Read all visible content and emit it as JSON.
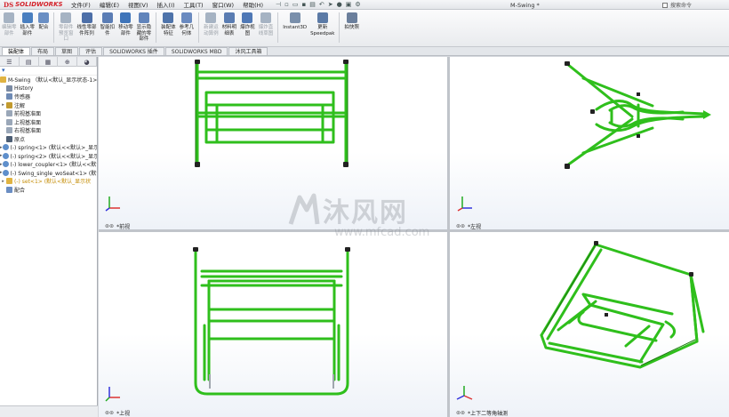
{
  "app": {
    "brand_ds": "DS",
    "brand_name": "SOLIDWORKS",
    "document_title": "M-Swing *",
    "search_label": "搜索命令"
  },
  "menus": [
    "文件(F)",
    "编辑(E)",
    "视图(V)",
    "插入(I)",
    "工具(T)",
    "窗口(W)",
    "帮助(H)"
  ],
  "toolbar": {
    "buttons": [
      {
        "label": "编辑零\n部件",
        "icon": "edit-component-icon",
        "enabled": false
      },
      {
        "label": "插入零\n部件",
        "icon": "insert-components-icon",
        "enabled": true
      },
      {
        "label": "配合",
        "icon": "mate-icon",
        "enabled": true
      },
      {
        "label": "零部件\n预览窗\n口",
        "icon": "component-preview-icon",
        "enabled": false
      },
      {
        "label": "线性零部\n件阵列",
        "icon": "linear-pattern-icon",
        "enabled": true
      },
      {
        "label": "智能扣\n件",
        "icon": "smart-fasteners-icon",
        "enabled": true
      },
      {
        "label": "移动零\n部件",
        "icon": "move-component-icon",
        "enabled": true
      },
      {
        "label": "显示隐\n藏的零\n部件",
        "icon": "show-hidden-icon",
        "enabled": true
      },
      {
        "label": "装配体\n特征",
        "icon": "assembly-features-icon",
        "enabled": true
      },
      {
        "label": "参考几\n何体",
        "icon": "reference-geometry-icon",
        "enabled": true
      },
      {
        "label": "新建运\n动算例",
        "icon": "new-motion-study-icon",
        "enabled": false
      },
      {
        "label": "材料明\n细表",
        "icon": "bom-icon",
        "enabled": true
      },
      {
        "label": "爆炸视\n图",
        "icon": "exploded-view-icon",
        "enabled": true
      },
      {
        "label": "爆炸直\n线草图",
        "icon": "explode-line-sketch-icon",
        "enabled": false
      },
      {
        "label": "Instant3D",
        "icon": "instant3d-icon",
        "enabled": true
      },
      {
        "label": "更新\nSpeedpak",
        "icon": "speedpak-icon",
        "enabled": true
      },
      {
        "label": "拍快照",
        "icon": "snapshot-icon",
        "enabled": true
      }
    ]
  },
  "tabs": [
    {
      "label": "装配体",
      "active": true
    },
    {
      "label": "布局",
      "active": false
    },
    {
      "label": "草图",
      "active": false
    },
    {
      "label": "评估",
      "active": false
    },
    {
      "label": "SOLIDWORKS 插件",
      "active": false
    },
    {
      "label": "SOLIDWORKS MBD",
      "active": false
    },
    {
      "label": "沐风工具箱",
      "active": false
    }
  ],
  "feature_tree": {
    "root": "M-Swing （默认<默认_显示状态-1>）",
    "items": [
      {
        "label": "History",
        "icon": "history-icon",
        "exp": ""
      },
      {
        "label": "传感器",
        "icon": "sensor-icon",
        "exp": ""
      },
      {
        "label": "注解",
        "icon": "annotation-icon",
        "exp": "▸"
      },
      {
        "label": "前视基准面",
        "icon": "plane-icon",
        "exp": ""
      },
      {
        "label": "上视基准面",
        "icon": "plane-icon",
        "exp": ""
      },
      {
        "label": "右视基准面",
        "icon": "plane-icon",
        "exp": ""
      },
      {
        "label": "原点",
        "icon": "origin-icon",
        "exp": ""
      },
      {
        "label": "(-) spring<1> (默认<<默认>_显示",
        "icon": "part-icon",
        "exp": "▸"
      },
      {
        "label": "(-) spring<2> (默认<<默认>_显示",
        "icon": "part-icon",
        "exp": "▸"
      },
      {
        "label": "(-) lower_coupler<1> (默认<<默认",
        "icon": "part-icon",
        "exp": "▸"
      },
      {
        "label": "(-) Swing_single_woSeat<1> (默认",
        "icon": "part-icon",
        "exp": "▸"
      },
      {
        "label": "(-) set<1> (默认<默认_显示状",
        "icon": "warning-icon",
        "exp": "▸",
        "warn": true
      },
      {
        "label": "配合",
        "icon": "mates-folder-icon",
        "exp": ""
      }
    ]
  },
  "viewports": [
    {
      "label": "*前视"
    },
    {
      "label": "*左视"
    },
    {
      "label": "*上视"
    },
    {
      "label": "*上下二等角轴测"
    }
  ],
  "watermark": {
    "text": "沐风网",
    "url": "www.mfcad.com"
  },
  "colors": {
    "model_green": "#2fbf1c",
    "model_dark": "#1a7a0e",
    "accent": "#d4222a"
  }
}
